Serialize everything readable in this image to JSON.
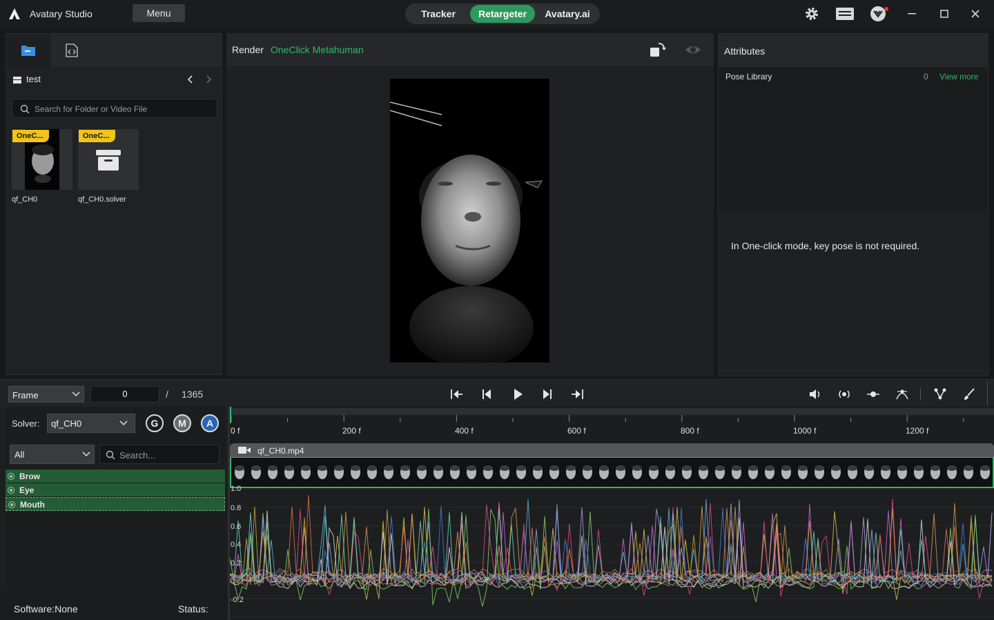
{
  "titlebar": {
    "app_name": "Avatary Studio",
    "menu_label": "Menu",
    "modes": [
      "Tracker",
      "Retargeter",
      "Avatary.ai"
    ],
    "active_mode": "Retargeter"
  },
  "left_panel": {
    "folder_name": "test",
    "search_placeholder": "Search for Folder or Video File",
    "items": [
      {
        "badge": "OneC...",
        "label": "qf_CH0"
      },
      {
        "badge": "OneC...",
        "label": "qf_CH0.solver"
      }
    ]
  },
  "render": {
    "title": "Render",
    "subtitle": "OneClick Metahuman"
  },
  "attributes": {
    "title": "Attributes",
    "pose_library_label": "Pose Library",
    "pose_count": "0",
    "view_more": "View more",
    "note": "In One-click mode, key pose is not required."
  },
  "toolbar": {
    "frame_mode": "Frame",
    "current_frame": "0",
    "separator": "/",
    "total_frames": "1365"
  },
  "solver": {
    "label": "Solver:",
    "value": "qf_CH0",
    "buttons": [
      "G",
      "M",
      "A"
    ],
    "filter": "All",
    "search_placeholder": "Search...",
    "controls": [
      "Brow",
      "Eye",
      "Mouth"
    ]
  },
  "status": {
    "software": "Software:None",
    "status": "Status:"
  },
  "timeline": {
    "ticks": [
      "0 f",
      "200 f",
      "400 f",
      "600 f",
      "800 f",
      "1000 f",
      "1200 f"
    ],
    "clip_name": "qf_CH0.mp4",
    "y_labels": [
      "1.0",
      "0.8",
      "0.6",
      "0.4",
      "0.2",
      "-0.2"
    ]
  },
  "colors": {
    "accent": "#2c9a5c",
    "accent_text": "#2fb86a",
    "badge": "#f0c419"
  }
}
